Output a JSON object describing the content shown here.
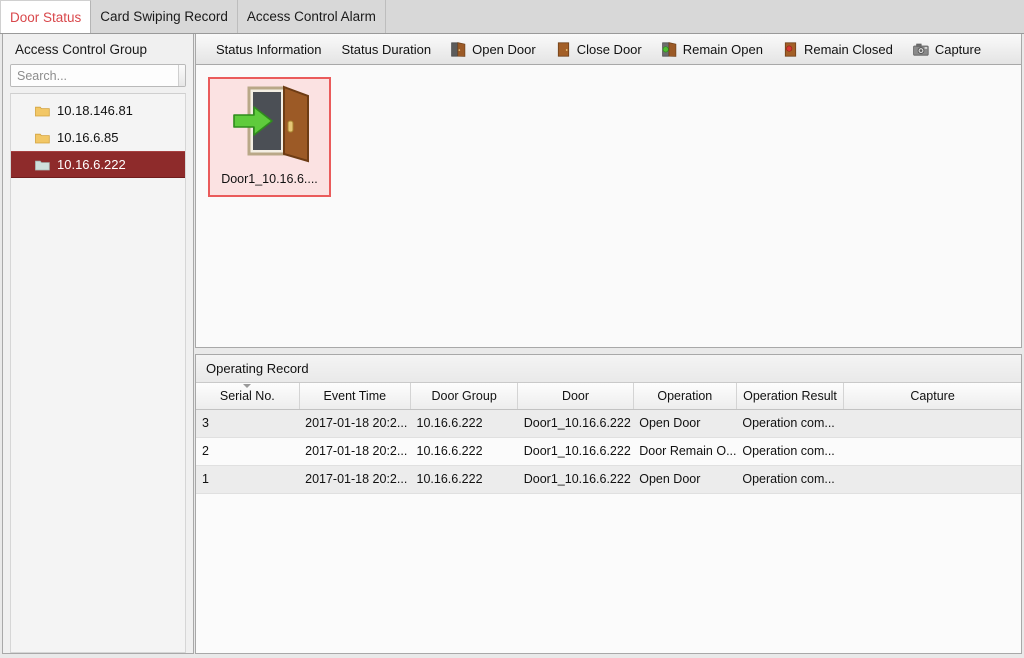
{
  "tabs": [
    {
      "label": "Door Status",
      "active": true
    },
    {
      "label": "Card Swiping Record",
      "active": false
    },
    {
      "label": "Access Control Alarm",
      "active": false
    }
  ],
  "sidebar": {
    "title": "Access Control Group",
    "search": {
      "value": "",
      "placeholder": "Search...",
      "icon": "search-icon"
    },
    "items": [
      {
        "label": "10.18.146.81",
        "icon": "folder-icon",
        "selected": false
      },
      {
        "label": "10.16.6.85",
        "icon": "folder-icon",
        "selected": false
      },
      {
        "label": "10.16.6.222",
        "icon": "folder-icon",
        "selected": true
      }
    ],
    "selected_color": "#8e2b2b"
  },
  "toolbar": {
    "items": [
      {
        "label": "Status Information",
        "icon": "none"
      },
      {
        "label": "Status Duration",
        "icon": "none"
      },
      {
        "label": "Open Door",
        "icon": "door-open-icon"
      },
      {
        "label": "Close Door",
        "icon": "door-closed-icon"
      },
      {
        "label": "Remain Open",
        "icon": "door-remain-open-icon"
      },
      {
        "label": "Remain Closed",
        "icon": "door-remain-closed-icon"
      },
      {
        "label": "Capture",
        "icon": "camera-icon"
      }
    ]
  },
  "door_area": {
    "card": {
      "label": "Door1_10.16.6....",
      "icon": "door-open-arrow-icon",
      "selected": true,
      "border_color": "#ea5b5b",
      "background_color": "#fbe2e2"
    }
  },
  "record": {
    "title": "Operating Record",
    "sort_column": "Serial No.",
    "columns": [
      "Serial No.",
      "Event Time",
      "Door Group",
      "Door",
      "Operation",
      "Operation Result",
      "Capture"
    ],
    "rows": [
      {
        "serial_no": "3",
        "event_time": "2017-01-18 20:2...",
        "door_group": "10.16.6.222",
        "door": "Door1_10.16.6.222",
        "operation": "Open Door",
        "operation_result": "Operation com...",
        "capture": ""
      },
      {
        "serial_no": "2",
        "event_time": "2017-01-18 20:2...",
        "door_group": "10.16.6.222",
        "door": "Door1_10.16.6.222",
        "operation": "Door Remain O...",
        "operation_result": "Operation com...",
        "capture": ""
      },
      {
        "serial_no": "1",
        "event_time": "2017-01-18 20:2...",
        "door_group": "10.16.6.222",
        "door": "Door1_10.16.6.222",
        "operation": "Open Door",
        "operation_result": "Operation com...",
        "capture": ""
      }
    ]
  }
}
